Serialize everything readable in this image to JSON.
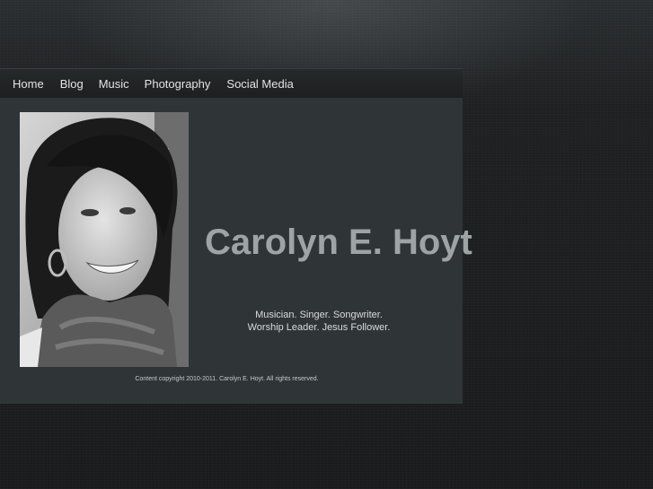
{
  "nav": {
    "items": [
      {
        "label": "Home"
      },
      {
        "label": "Blog"
      },
      {
        "label": "Music"
      },
      {
        "label": "Photography"
      },
      {
        "label": "Social Media"
      }
    ]
  },
  "main": {
    "name": "Carolyn E. Hoyt",
    "tagline_line1": "Musician.  Singer.  Songwriter.",
    "tagline_line2": "Worship Leader.  Jesus Follower."
  },
  "footer": {
    "copyright": "Content copyright 2010-2011. Carolyn E. Hoyt. All rights reserved."
  },
  "colors": {
    "background": "#1e2022",
    "content_panel": "#2f3537",
    "nav_text": "#e2e4e6",
    "name_text": "#9ea3a5"
  }
}
